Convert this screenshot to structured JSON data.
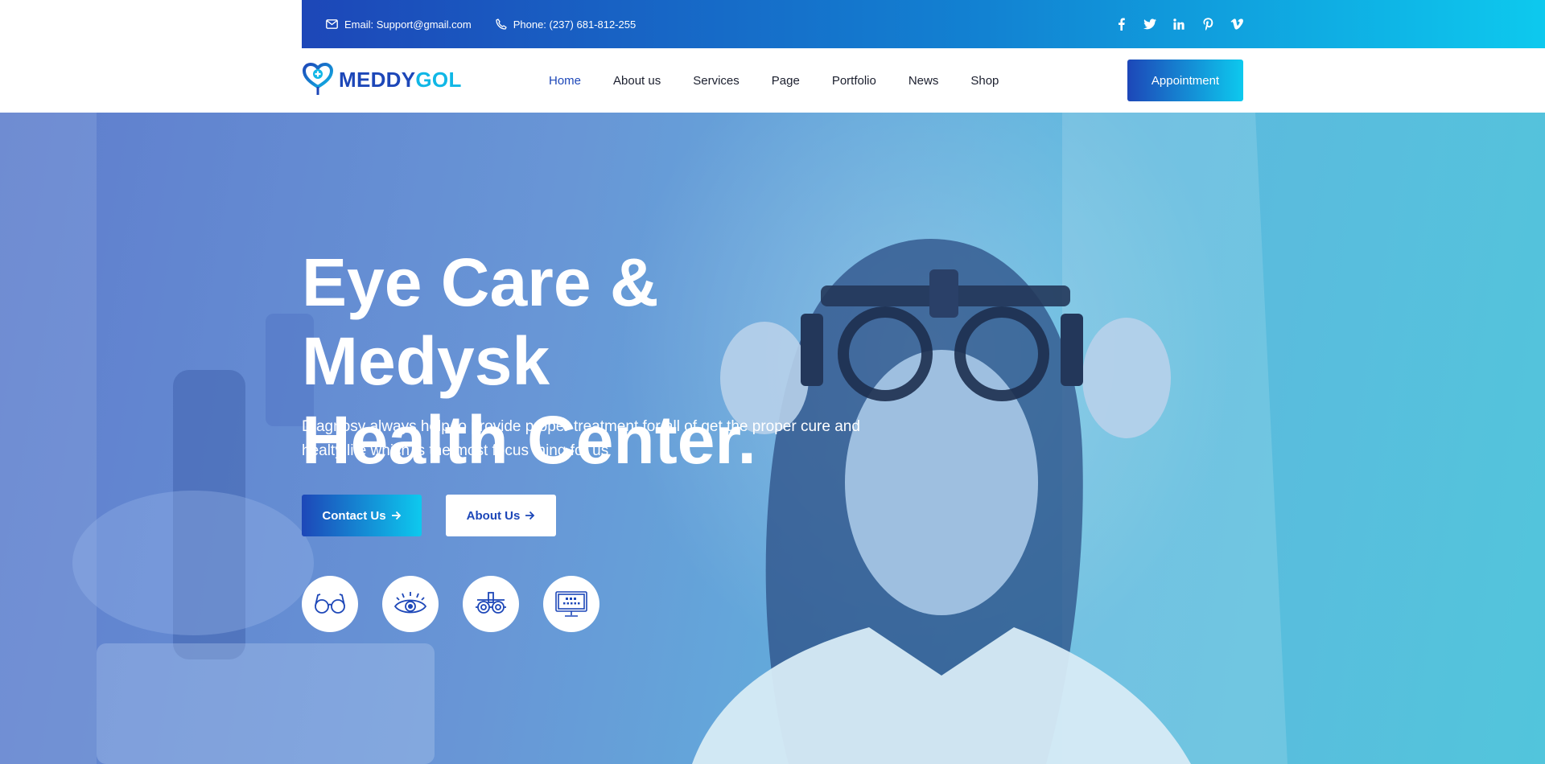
{
  "topbar": {
    "email": "Email: Support@gmail.com",
    "phone": "Phone: (237) 681-812-255",
    "socials": [
      "facebook-icon",
      "twitter-icon",
      "linkedin-icon",
      "pinterest-icon",
      "vimeo-icon"
    ]
  },
  "brand": {
    "part1": "MEDDY",
    "part2": "GOL",
    "primary_color": "#1d47b8",
    "accent_color": "#10b7e6"
  },
  "nav": {
    "items": [
      {
        "label": "Home"
      },
      {
        "label": "About us"
      },
      {
        "label": "Services"
      },
      {
        "label": "Page"
      },
      {
        "label": "Portfolio"
      },
      {
        "label": "News"
      },
      {
        "label": "Shop"
      }
    ],
    "appointment": "Appointment"
  },
  "hero": {
    "title_line1": "Eye Care & Medysk",
    "title_line2": "Health Center.",
    "description": "Diagnosy always help to provide proper treatment for all of get the proper cure and healty life which is the most focus thing for us",
    "contact_button": "Contact Us",
    "about_button": "About Us",
    "features": [
      "glasses-icon",
      "eye-icon",
      "trial-frame-icon",
      "eye-chart-monitor-icon"
    ]
  }
}
